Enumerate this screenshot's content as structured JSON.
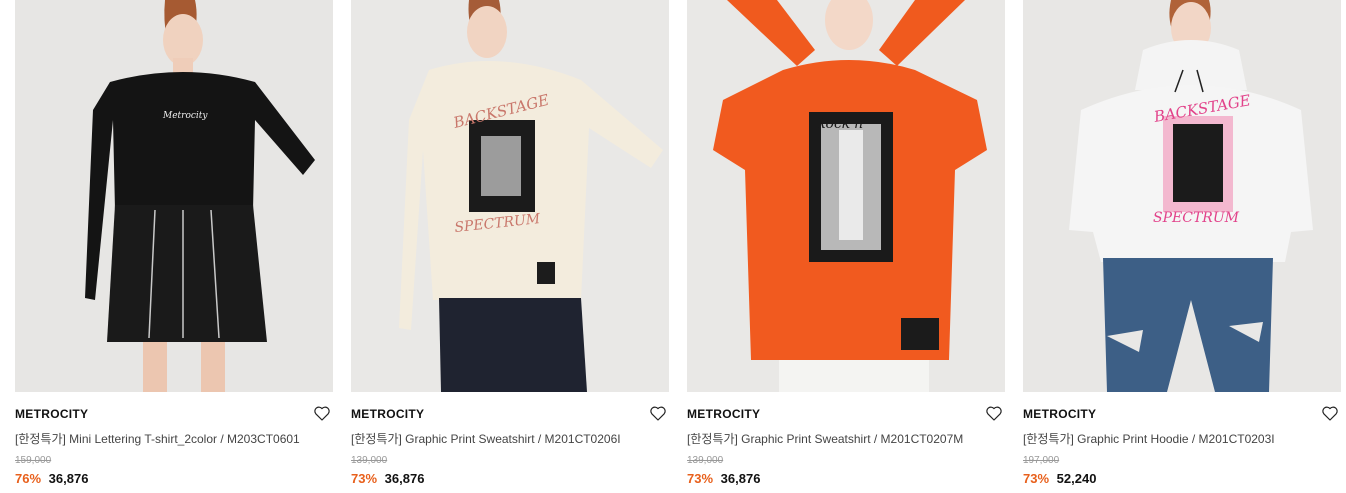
{
  "colors": {
    "discount": "#e8601c",
    "original_price": "#999999"
  },
  "products": [
    {
      "brand": "METROCITY",
      "title": "[한정특가] Mini Lettering T-shirt_2color / M203CT0601",
      "original_price": "159,000",
      "discount_rate": "76%",
      "sale_price": "36,876",
      "wishlist_icon": "heart-outline-icon"
    },
    {
      "brand": "METROCITY",
      "title": "[한정특가] Graphic Print Sweatshirt / M201CT0206I",
      "original_price": "139,000",
      "discount_rate": "73%",
      "sale_price": "36,876",
      "wishlist_icon": "heart-outline-icon"
    },
    {
      "brand": "METROCITY",
      "title": "[한정특가] Graphic Print Sweatshirt / M201CT0207M",
      "original_price": "139,000",
      "discount_rate": "73%",
      "sale_price": "36,876",
      "wishlist_icon": "heart-outline-icon"
    },
    {
      "brand": "METROCITY",
      "title": "[한정특가] Graphic Print Hoodie / M201CT0203I",
      "original_price": "197,000",
      "discount_rate": "73%",
      "sale_price": "52,240",
      "wishlist_icon": "heart-outline-icon"
    }
  ]
}
